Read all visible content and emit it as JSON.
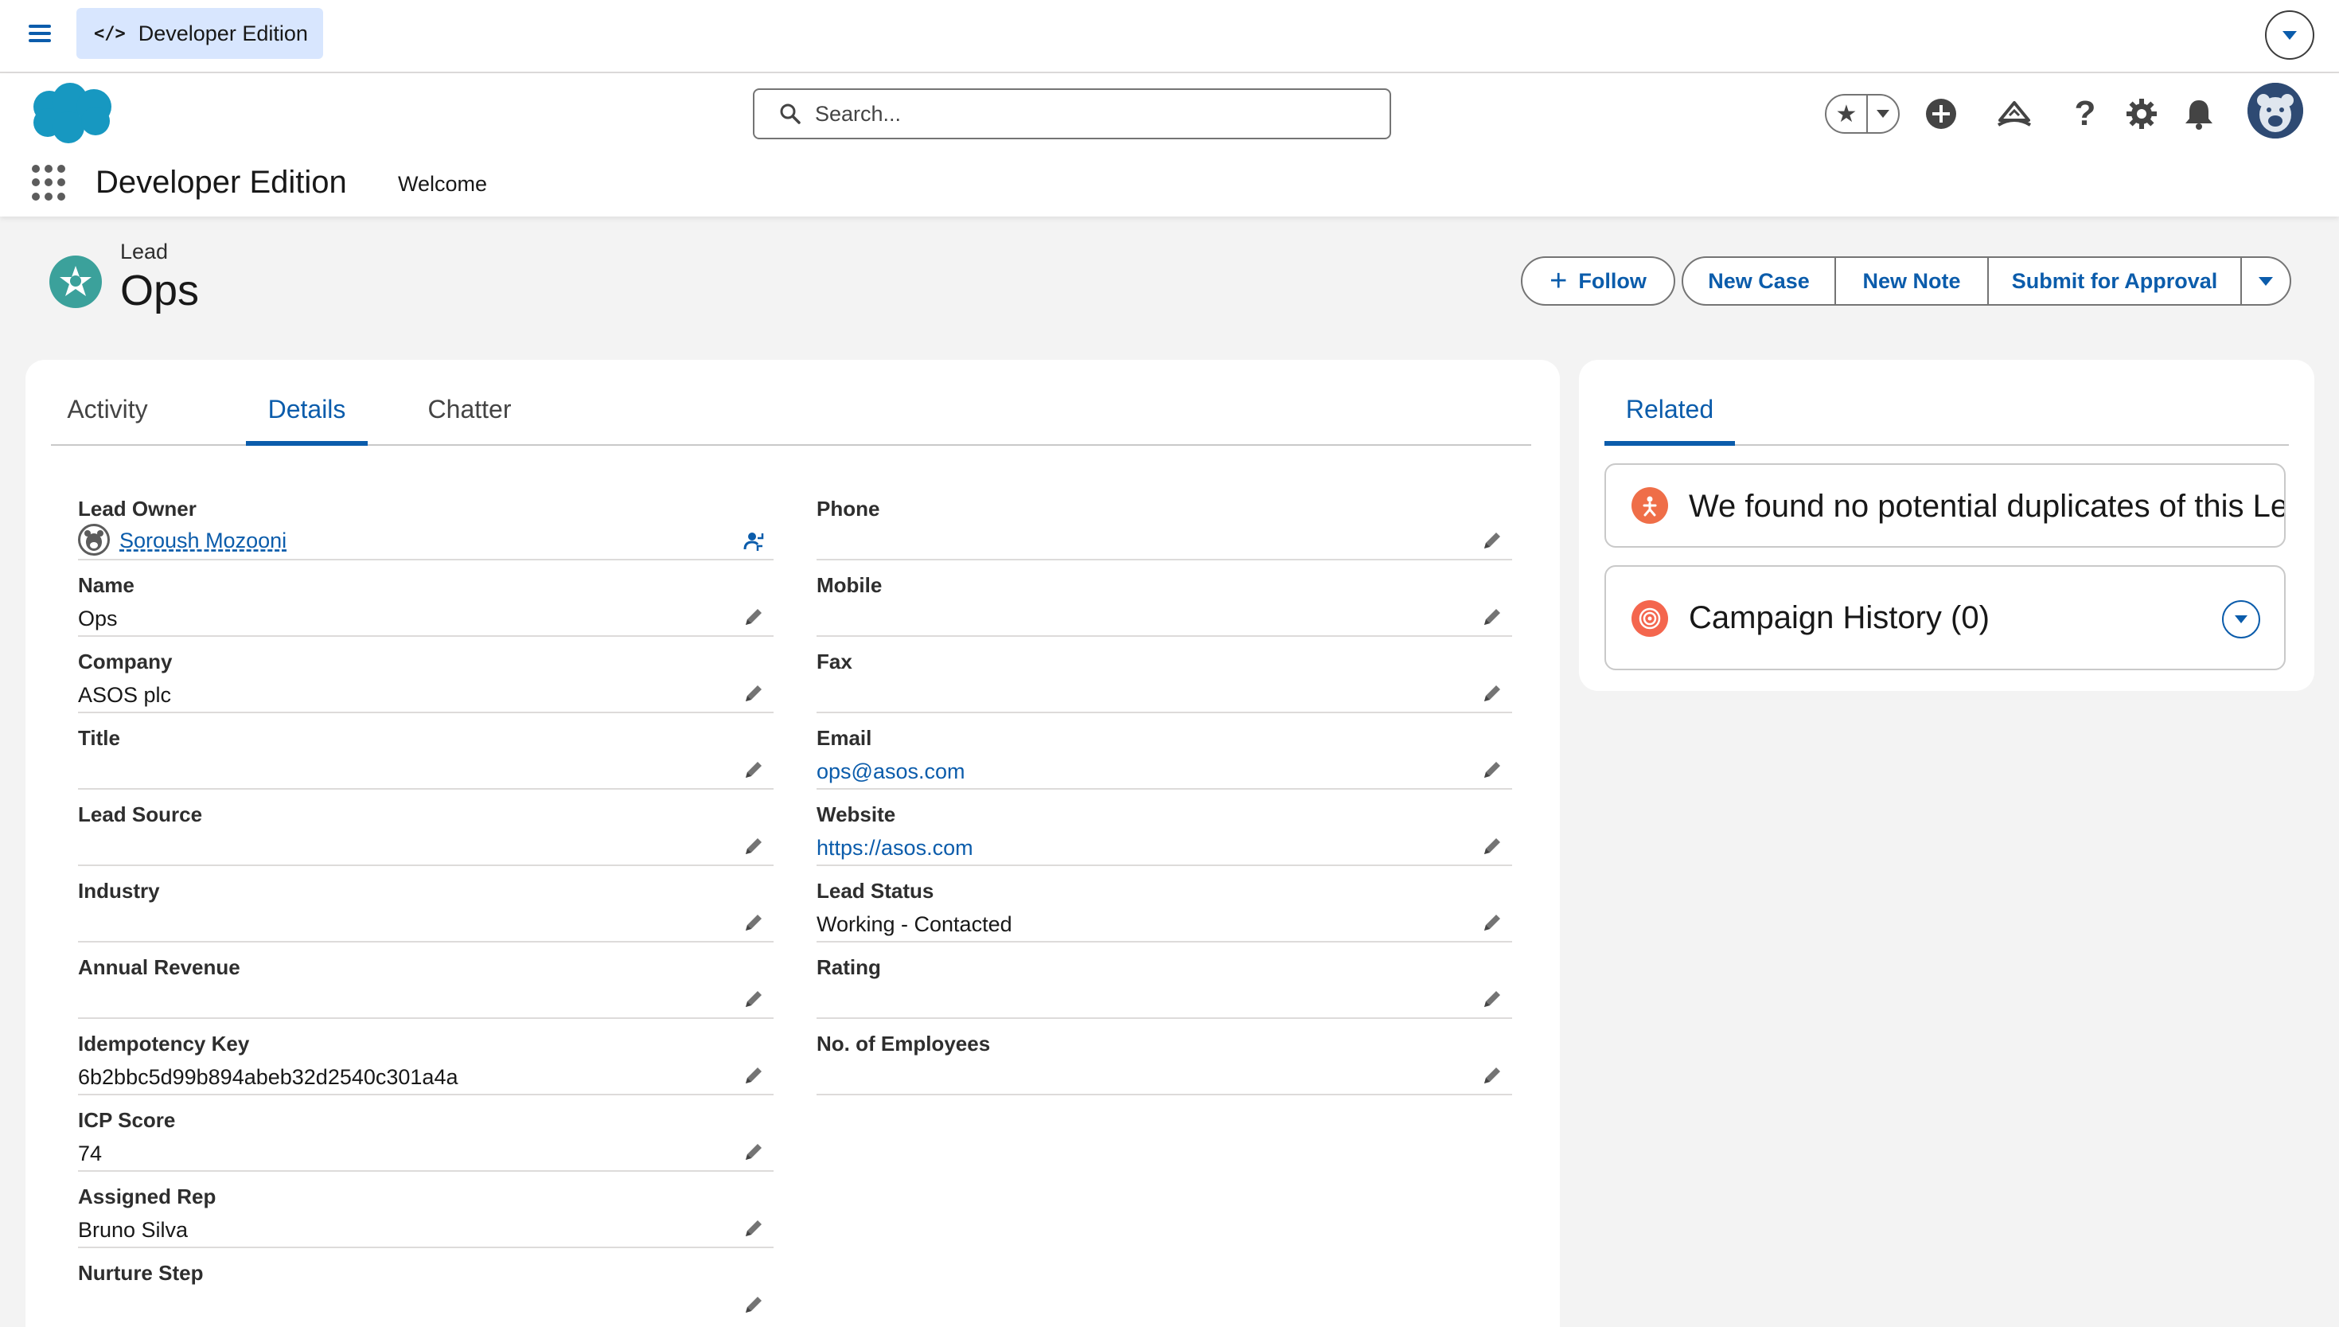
{
  "topbar": {
    "badge_label": "Developer Edition",
    "badge_icon": "code-icon"
  },
  "header": {
    "search_placeholder": "Search...",
    "app_name": "Developer Edition",
    "nav_items": [
      "Welcome"
    ]
  },
  "record": {
    "type_label": "Lead",
    "name": "Ops",
    "icon": "lead-icon",
    "actions": {
      "follow": "Follow",
      "new_case": "New Case",
      "new_note": "New Note",
      "submit": "Submit for Approval"
    }
  },
  "tabs": [
    {
      "label": "Activity",
      "active": false
    },
    {
      "label": "Details",
      "active": true
    },
    {
      "label": "Chatter",
      "active": false
    }
  ],
  "details": {
    "left": [
      {
        "label": "Lead Owner",
        "value": "Soroush Mozooni"
      },
      {
        "label": "Name",
        "value": "Ops"
      },
      {
        "label": "Company",
        "value": "ASOS plc"
      },
      {
        "label": "Title",
        "value": ""
      },
      {
        "label": "Lead Source",
        "value": ""
      },
      {
        "label": "Industry",
        "value": ""
      },
      {
        "label": "Annual Revenue",
        "value": ""
      },
      {
        "label": "Idempotency Key",
        "value": "6b2bbc5d99b894abeb32d2540c301a4a"
      },
      {
        "label": "ICP Score",
        "value": "74"
      },
      {
        "label": "Assigned Rep",
        "value": "Bruno Silva"
      },
      {
        "label": "Nurture Step",
        "value": ""
      }
    ],
    "right": [
      {
        "label": "Phone",
        "value": ""
      },
      {
        "label": "Mobile",
        "value": ""
      },
      {
        "label": "Fax",
        "value": ""
      },
      {
        "label": "Email",
        "value": "ops@asos.com"
      },
      {
        "label": "Website",
        "value": "https://asos.com"
      },
      {
        "label": "Lead Status",
        "value": "Working - Contacted"
      },
      {
        "label": "Rating",
        "value": ""
      },
      {
        "label": "No. of Employees",
        "value": ""
      }
    ]
  },
  "related": {
    "tab_label": "Related",
    "duplicates_text": "We found no potential duplicates of this Lead.",
    "campaign_history": "Campaign History (0)"
  },
  "colors": {
    "brand_blue": "#0b5cab",
    "lead_icon": "#3ba19b",
    "duplicate_icon": "#ef6e48",
    "campaign_icon": "#f4664e"
  }
}
